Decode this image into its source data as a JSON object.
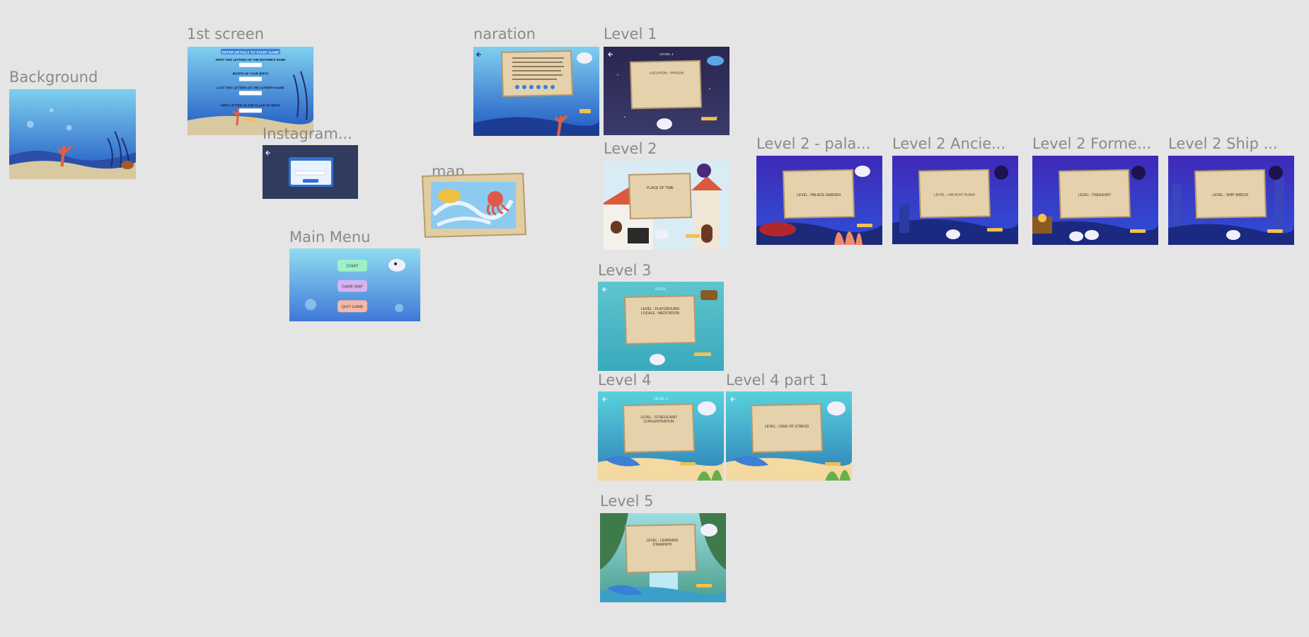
{
  "canvas": {
    "background": "#e5e5e5",
    "label_color": "#8a8a8a"
  },
  "frames": {
    "background": {
      "label": "Background"
    },
    "first_screen": {
      "label": "1st screen",
      "banner": "ENTER DETAILS TO START GAME",
      "field1": "FIRST TWO LETTERS OF THE MOTHER'S NAME",
      "field2": "MONTH OF YOUR BIRTH",
      "field3": "LAST TWO LETTERS OF THE FATHER'S NAME",
      "field4": "FIRST LETTER OF THE PLACE OF BIRTH"
    },
    "instagram": {
      "label": "Instagram..."
    },
    "map": {
      "label": "map"
    },
    "main_menu": {
      "label": "Main Menu",
      "start": "START",
      "game_map": "GAME MAP",
      "quit": "QUIT GAME"
    },
    "naration": {
      "label": "naration"
    },
    "level1": {
      "label": "Level 1",
      "title": "LEVEL 1",
      "text": "LOCATION : PRISON"
    },
    "level2": {
      "label": "Level 2",
      "text": "PLACE OF TIME"
    },
    "level2_palace": {
      "label": "Level 2 - pala...",
      "text": "LEVEL : PALACE GARDEN"
    },
    "level2_ancient": {
      "label": "Level 2 Ancie...",
      "text": "LEVEL : ANCIENT RUINS"
    },
    "level2_former": {
      "label": "Level 2 Forme...",
      "text": "LEVEL : TREASURY"
    },
    "level2_ship": {
      "label": "Level 2 Ship ...",
      "text": "LEVEL : SHIP WRECK"
    },
    "level3": {
      "label": "Level 3",
      "title": "LEVEL",
      "text1": "LEVEL : PLAYGROUND",
      "text2": "LOCALE : MEDITATION"
    },
    "level4": {
      "label": "Level 4",
      "title": "LEVEL 4",
      "text1": "LEVEL : STRESS AND",
      "text2": "CONCENTRATION"
    },
    "level4_part1": {
      "label": "Level 4 part 1",
      "text": "LEVEL : CAVE OF STRESS"
    },
    "level5": {
      "label": "Level 5",
      "text1": "LEVEL : LEARNING",
      "text2": "STAIRPATH"
    }
  }
}
